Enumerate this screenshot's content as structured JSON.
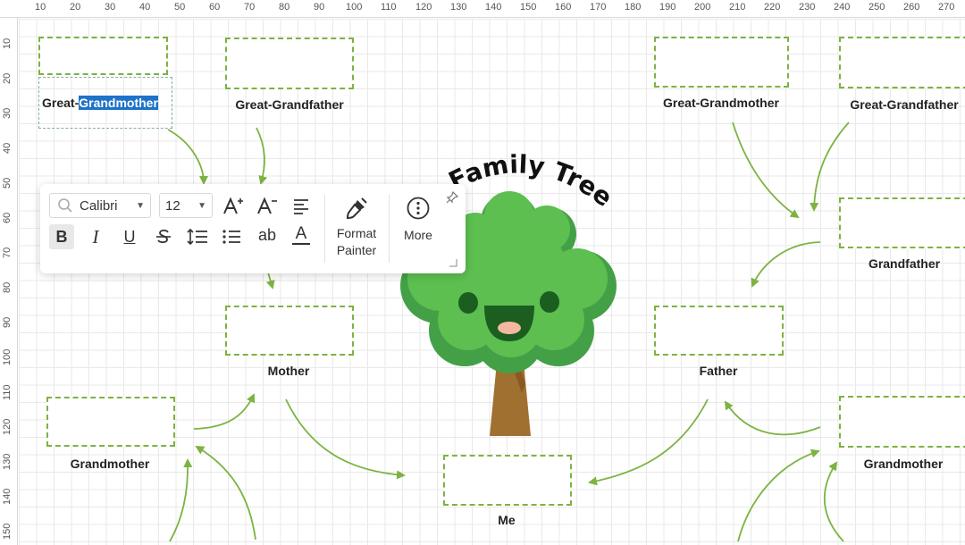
{
  "rulers": {
    "top": [
      "10",
      "20",
      "30",
      "40",
      "50",
      "60",
      "70",
      "80",
      "90",
      "100",
      "110",
      "120",
      "130",
      "140",
      "150",
      "160",
      "170",
      "180",
      "190",
      "200",
      "210",
      "220",
      "230",
      "240",
      "250",
      "260",
      "270"
    ],
    "left": [
      "10",
      "20",
      "30",
      "40",
      "50",
      "60",
      "70",
      "80",
      "90",
      "100",
      "110",
      "120",
      "130",
      "140",
      "150"
    ]
  },
  "title": "Family Tree",
  "labels": {
    "great_grandmother_left_prefix": "Great-",
    "great_grandmother_left_selected": "Grandmother",
    "great_grandfather_left": "Great-Grandfather",
    "great_grandmother_right": "Great-Grandmother",
    "great_grandfather_right": "Great-Grandfather",
    "grandfather_right": "Grandfather",
    "mother": "Mother",
    "father": "Father",
    "grandmother_left": "Grandmother",
    "grandmother_right": "Grandmother",
    "me": "Me"
  },
  "toolbar": {
    "font_family": "Calibri",
    "font_size": "12",
    "format_painter_line1": "Format",
    "format_painter_line2": "Painter",
    "more": "More",
    "underline_glyph": "U",
    "italic_glyph": "I",
    "bold_glyph": "B",
    "ab_glyph": "ab",
    "color_glyph": "A"
  },
  "colors": {
    "accent_green": "#7cb342",
    "selection_blue": "#1e72c8",
    "tree_green": "#4caf50",
    "trunk_brown": "#a07030"
  }
}
